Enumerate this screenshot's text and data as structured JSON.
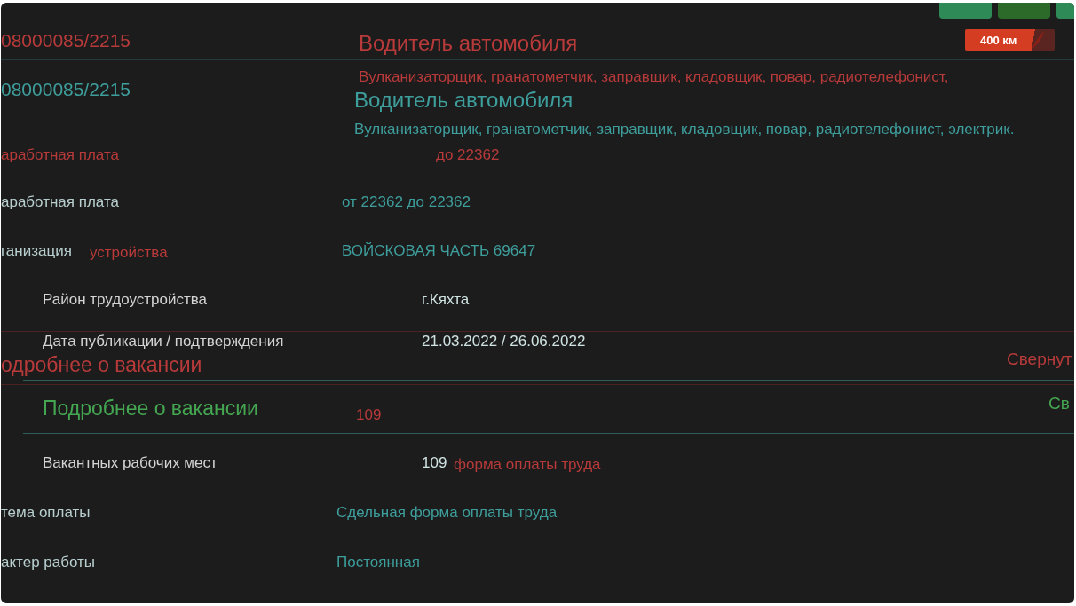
{
  "toolbar_buttons": [
    {
      "kind": "light"
    },
    {
      "kind": "dark"
    },
    {
      "kind": "light"
    }
  ],
  "distance_badge": {
    "label": "400 км"
  },
  "ghost_layer": {
    "fragments": [
      {
        "text": "08000085/2215"
      },
      {
        "text": "Водитель автомобиля"
      },
      {
        "text": "Вулканизаторщик, гранатометчик, заправщик, кладовщик, повар, радиотелефонист,"
      },
      {
        "text": "аработная плата"
      },
      {
        "text": "до 22362"
      },
      {
        "text": "устройства"
      },
      {
        "text": "одробнее о вакансии"
      },
      {
        "text": "Свернут"
      },
      {
        "text": "109"
      },
      {
        "text": "форма оплаты труда"
      }
    ]
  },
  "main_layer": {
    "number": "08000085/2215",
    "title": "Водитель автомобиля",
    "skills": "Вулканизаторщик, гранатометчик, заправщик, кладовщик, повар, радиотелефонист, электрик.",
    "rows": [
      {
        "label": "аработная плата",
        "value": "от 22362 до 22362"
      },
      {
        "label": "ганизация",
        "value": "ВОЙСКОВАЯ ЧАСТЬ 69647"
      }
    ],
    "rows_after": [
      {
        "label": "тема оплаты",
        "value": "Сдельная форма оплаты труда"
      },
      {
        "label": "актер работы",
        "value": "Постоянная"
      }
    ]
  },
  "front_layer": {
    "rows": [
      {
        "label": "Район трудоустройства",
        "value": "г.Кяхта"
      },
      {
        "label": "Дата публикации / подтверждения",
        "value": "21.03.2022 / 26.06.2022"
      }
    ],
    "section": {
      "title": "Подробнее о вакансии",
      "toggle": "Св"
    },
    "rows_after": [
      {
        "label": "Вакантных рабочих мест",
        "value": "109"
      }
    ]
  }
}
